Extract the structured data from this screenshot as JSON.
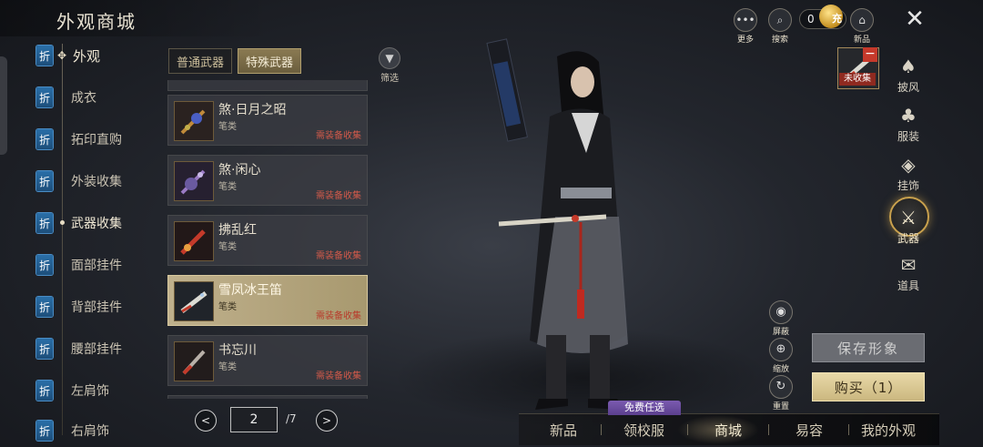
{
  "header": {
    "title": "外观商城"
  },
  "nav": {
    "badge": "折",
    "items": [
      {
        "label": "外观"
      },
      {
        "label": "成衣"
      },
      {
        "label": "拓印直购"
      },
      {
        "label": "外装收集"
      },
      {
        "label": "武器收集"
      },
      {
        "label": "面部挂件"
      },
      {
        "label": "背部挂件"
      },
      {
        "label": "腰部挂件"
      },
      {
        "label": "左肩饰"
      },
      {
        "label": "右肩饰"
      }
    ]
  },
  "tabs": [
    {
      "label": "普通武器"
    },
    {
      "label": "特殊武器"
    }
  ],
  "filter": {
    "label": "筛选"
  },
  "items": [
    {
      "name": "煞·日月之昭",
      "type": "笔类",
      "status": "需装备收集"
    },
    {
      "name": "煞·闲心",
      "type": "笔类",
      "status": "需装备收集"
    },
    {
      "name": "拂乱红",
      "type": "笔类",
      "status": "需装备收集"
    },
    {
      "name": "雪凤冰王笛",
      "type": "笔类",
      "status": "需装备收集"
    },
    {
      "name": "书忘川",
      "type": "笔类",
      "status": "需装备收集"
    }
  ],
  "pagination": {
    "prev": "<",
    "current": "2",
    "total": "/7",
    "next": ">"
  },
  "top": {
    "more_label": "更多",
    "search_label": "搜索",
    "currency_value": "0",
    "charge_label": "充",
    "new_label": "新品"
  },
  "uncollected": {
    "label": "未收集"
  },
  "categories": [
    {
      "label": "披风"
    },
    {
      "label": "服装"
    },
    {
      "label": "挂饰"
    },
    {
      "label": "武器"
    },
    {
      "label": "道具"
    }
  ],
  "side": {
    "hide_label": "屏蔽",
    "zoom_label": "缩放",
    "reset_label": "重置"
  },
  "actions": {
    "save": "保存形象",
    "buy": "购买（1）"
  },
  "bottom": {
    "free_tag": "免费任选",
    "items": [
      {
        "label": "新品"
      },
      {
        "label": "领校服"
      },
      {
        "label": "商城"
      },
      {
        "label": "易容"
      },
      {
        "label": "我的外观"
      }
    ]
  },
  "colors": {
    "accent_gold": "#c9a14d",
    "badge_blue": "#2a6fa8",
    "status_red": "#d25a4a"
  }
}
